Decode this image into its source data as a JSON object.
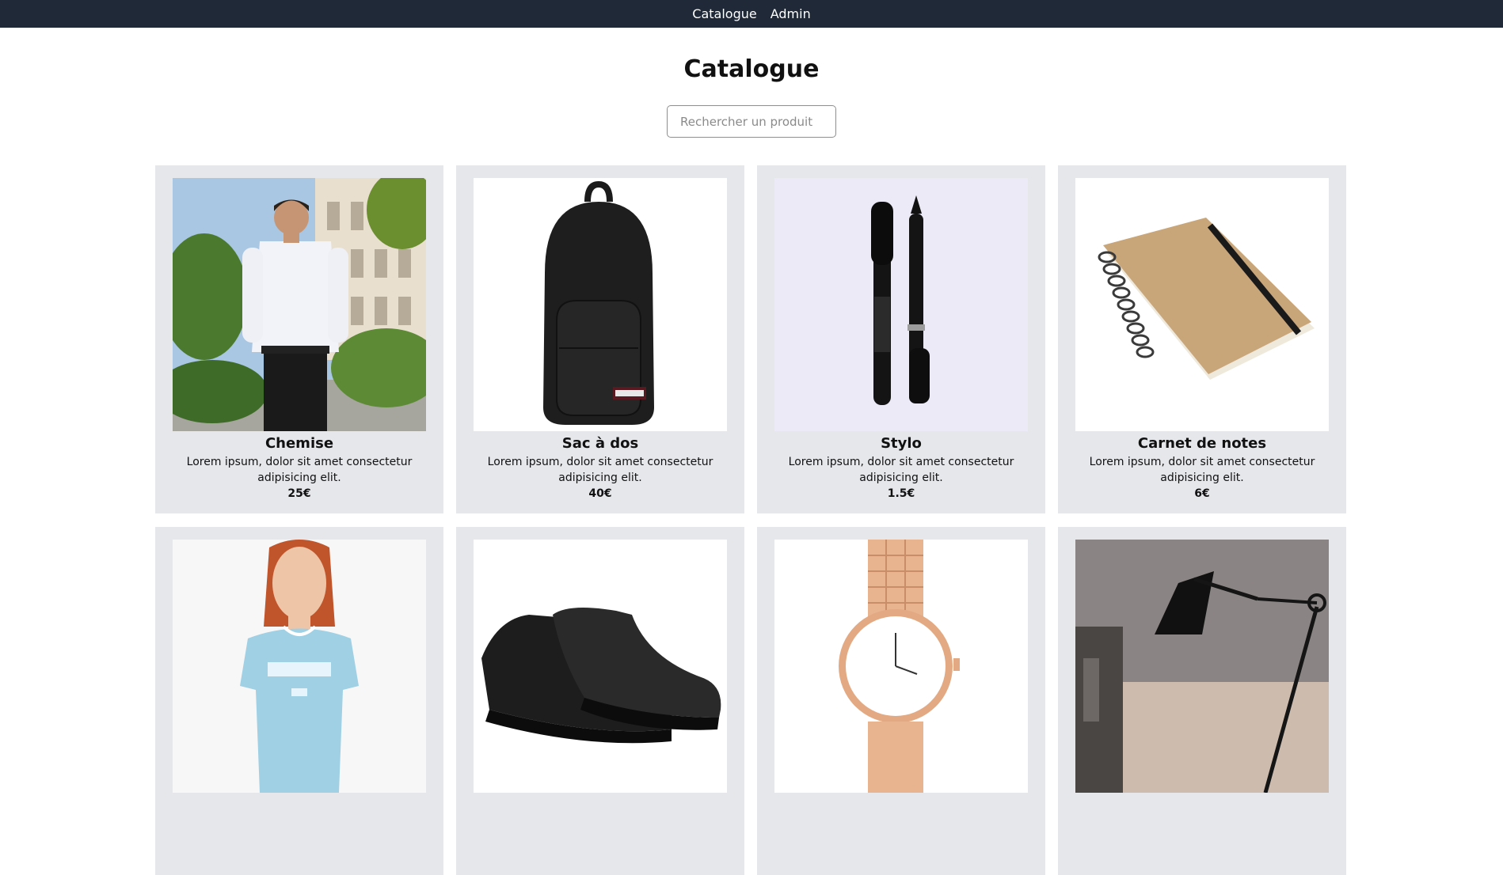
{
  "nav": {
    "links": [
      "Catalogue",
      "Admin"
    ]
  },
  "page": {
    "title": "Catalogue"
  },
  "search": {
    "placeholder": "Rechercher un produit",
    "value": ""
  },
  "products": [
    {
      "name": "Chemise",
      "description": "Lorem ipsum, dolor sit amet consectetur adipisicing elit.",
      "price": "25€",
      "image_icon": "shirt-man-photo"
    },
    {
      "name": "Sac à dos",
      "description": "Lorem ipsum, dolor sit amet consectetur adipisicing elit.",
      "price": "40€",
      "image_icon": "backpack-photo"
    },
    {
      "name": "Stylo",
      "description": "Lorem ipsum, dolor sit amet consectetur adipisicing elit.",
      "price": "1.5€",
      "image_icon": "pens-photo"
    },
    {
      "name": "Carnet de notes",
      "description": "Lorem ipsum, dolor sit amet consectetur adipisicing elit.",
      "price": "6€",
      "image_icon": "notebook-photo"
    },
    {
      "name": "",
      "description": "",
      "price": "",
      "image_icon": "tshirt-woman-photo"
    },
    {
      "name": "",
      "description": "",
      "price": "",
      "image_icon": "shoes-photo"
    },
    {
      "name": "",
      "description": "",
      "price": "",
      "image_icon": "watch-photo"
    },
    {
      "name": "",
      "description": "",
      "price": "",
      "image_icon": "desk-lamp-photo"
    }
  ],
  "colors": {
    "topbar": "#1f2937",
    "card_bg": "#e5e7eb"
  }
}
